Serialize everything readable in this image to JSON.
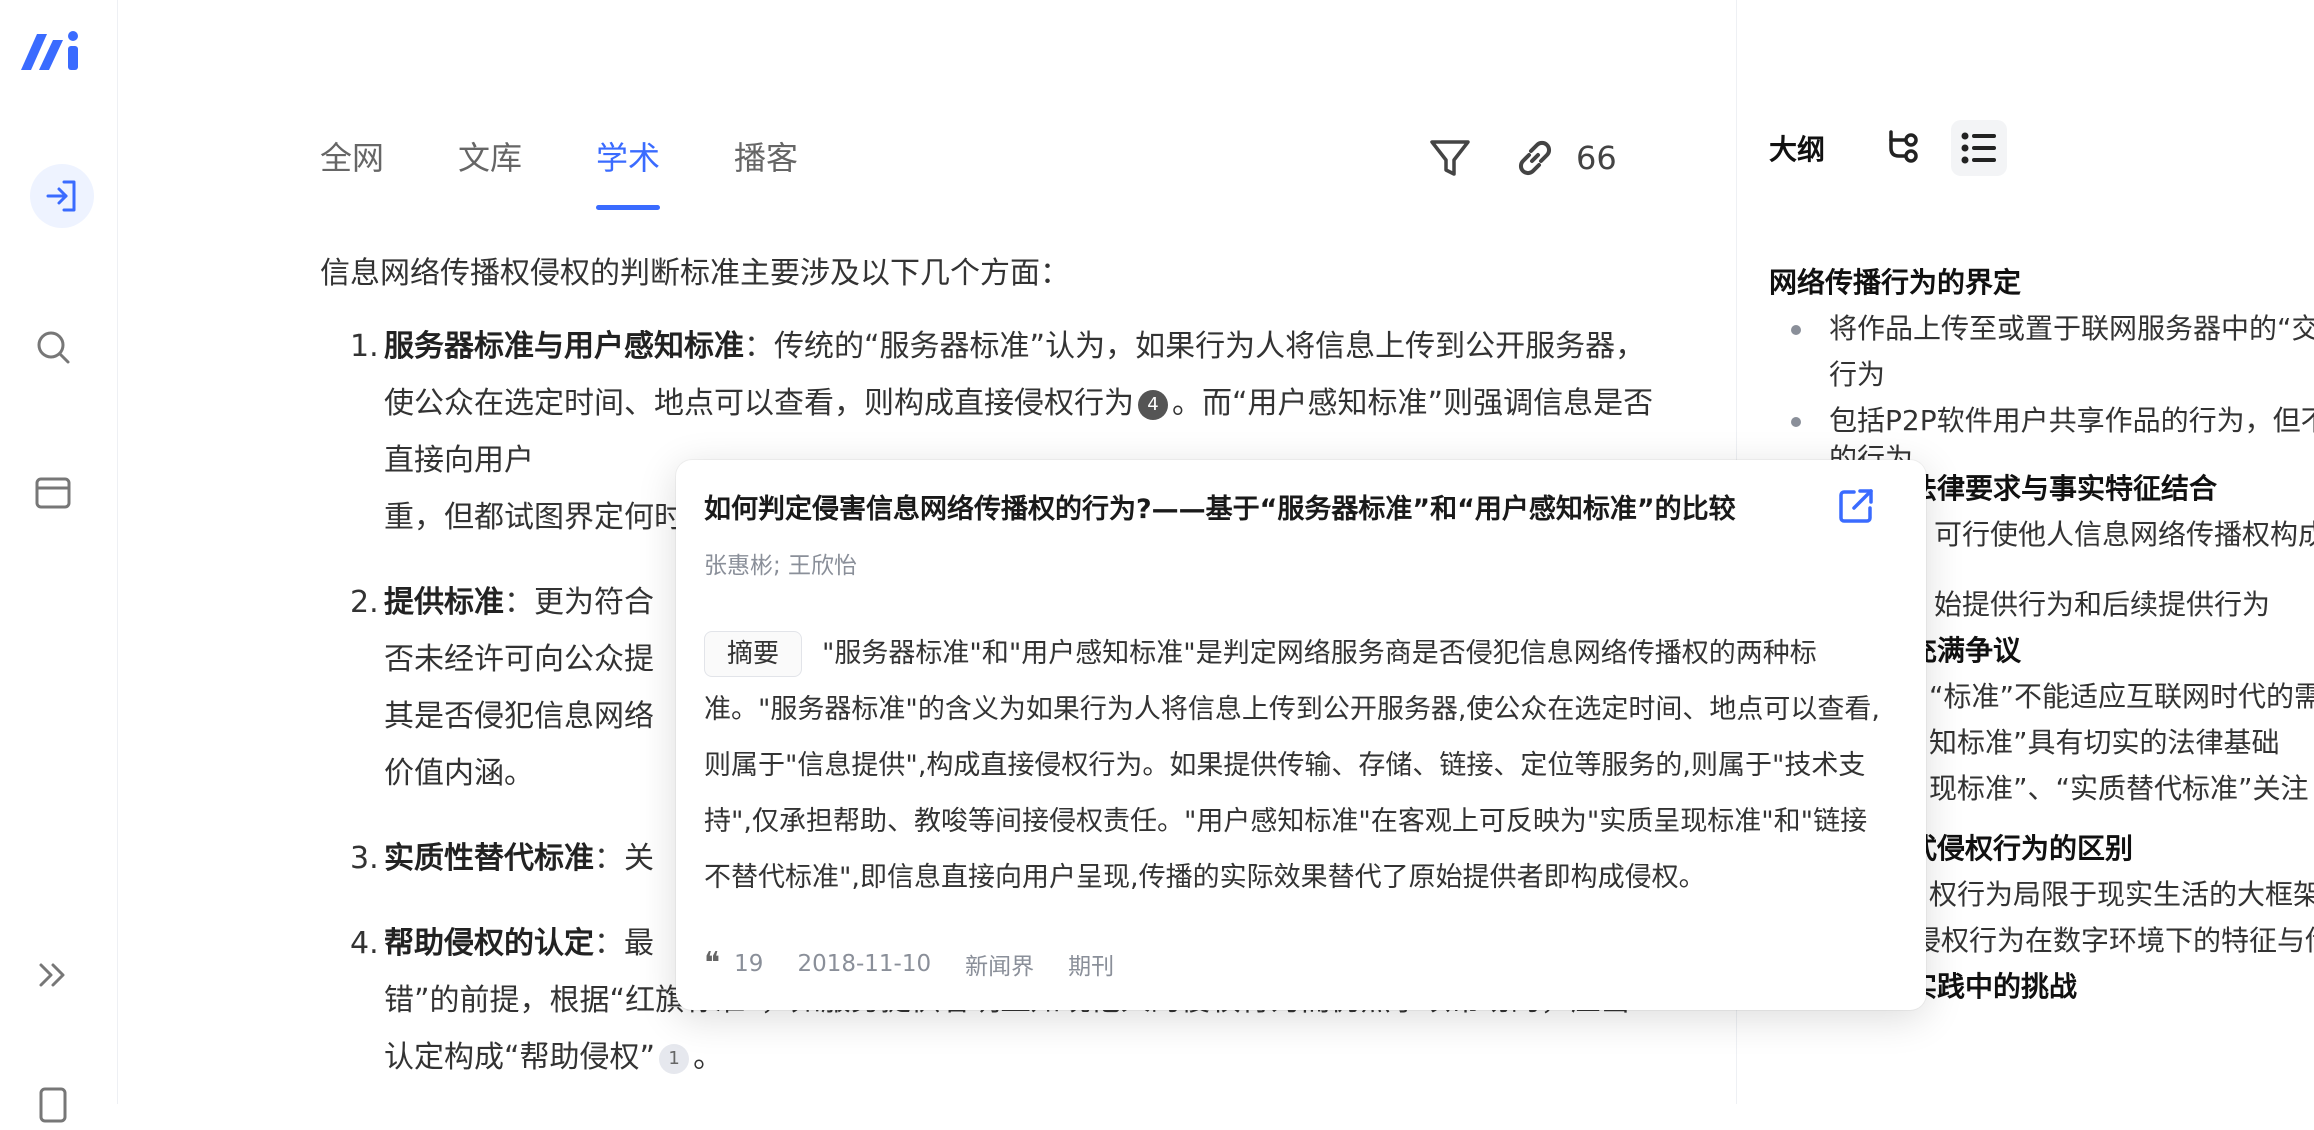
{
  "tabs": [
    {
      "label": "全网",
      "active": false
    },
    {
      "label": "文库",
      "active": false
    },
    {
      "label": "学术",
      "active": true
    },
    {
      "label": "播客",
      "active": false
    }
  ],
  "toolbar": {
    "link_count": "66"
  },
  "content": {
    "intro": "信息网络传播权侵权的判断标准主要涉及以下几个方面：",
    "items": [
      {
        "num": "1.",
        "title": "服务器标准与用户感知标准",
        "text_a": "：传统的“服务器标准”认为，如果行为人将信息上传到公开服务器，使公众在选定时间、地点可以查看，则构成直接侵权行为",
        "cite": "4",
        "text_b": "。而“用户感知标准”则强调信息是否直接向用户",
        "text_c": "重，但都试图界定何时"
      },
      {
        "num": "2.",
        "title": "提供标准",
        "text_a": "：更为符合",
        "text_b": "否未经许可向公众提",
        "text_c": "其是否侵犯信息网络",
        "text_d": "价值内涵。"
      },
      {
        "num": "3.",
        "title": "实质性替代标准",
        "text_a": "：关"
      },
      {
        "num": "4.",
        "title": "帮助侵权的认定",
        "text_a": "：最",
        "text_b": "错”的前提，根据“红旗标准”，如服务提供者明显知晓他人的侵权行为而仍然予以帮助的，应当认定构成“帮助侵权”",
        "cite": "1",
        "text_c": "。"
      }
    ]
  },
  "outline": {
    "title": "大纲",
    "lines": [
      {
        "kind": "sec",
        "text": "网络传播行为的界定"
      },
      {
        "kind": "bul",
        "text": "将作品上传至或置于联网服务器中的“交"
      },
      {
        "kind": "plain",
        "text": "行为"
      },
      {
        "kind": "bul",
        "text": "包括P2P软件用户共享作品的行为，但不"
      },
      {
        "kind": "plain",
        "text": "的行为"
      },
      {
        "kind": "sec",
        "text": "法律要求与事实特征结合"
      },
      {
        "kind": "plain",
        "text": "可行使他人信息网络传播权构成直"
      },
      {
        "kind": "plain",
        "text": ""
      },
      {
        "kind": "plain",
        "text": "始提供行为和后续提供行为"
      },
      {
        "kind": "sec",
        "text": "充满争议"
      },
      {
        "kind": "plain",
        "text": "“标准”不能适应互联网时代的需求"
      },
      {
        "kind": "plain",
        "text": "知标准”具有切实的法律基础"
      },
      {
        "kind": "plain",
        "text": "现标准”、“实质替代标准”关注"
      },
      {
        "kind": "plain",
        "text": ""
      },
      {
        "kind": "sec",
        "text": "式侵权行为的区别"
      },
      {
        "kind": "plain",
        "text": "权行为局限于现实生活的大框架之"
      },
      {
        "kind": "bul",
        "text": "新形式侵权行为在数字环境下的特征与传"
      },
      {
        "kind": "sec",
        "text": "法律规定与实践中的挑战"
      }
    ]
  },
  "popup": {
    "title": "如何判定侵害信息网络传播权的行为?——基于“服务器标准”和“用户感知标准”的比较",
    "authors": "张惠彬; 王欣怡",
    "abstract_label": "摘要",
    "abstract": "\"服务器标准\"和\"用户感知标准\"是判定网络服务商是否侵犯信息网络传播权的两种标准。\"服务器标准\"的含义为如果行为人将信息上传到公开服务器,使公众在选定时间、地点可以查看,则属于\"信息提供\",构成直接侵权行为。如果提供传输、存储、链接、定位等服务的,则属于\"技术支持\",仅承担帮助、教唆等间接侵权责任。\"用户感知标准\"在客观上可反映为\"实质呈现标准\"和\"链接不替代标准\",即信息直接向用户呈现,传播的实际效果替代了原始提供者即构成侵权。",
    "citations": "19",
    "date": "2018-11-10",
    "journal": "新闻界",
    "type": "期刊"
  },
  "colors": {
    "accent": "#3a6bff",
    "text": "#333333",
    "muted": "#8a8f99"
  }
}
